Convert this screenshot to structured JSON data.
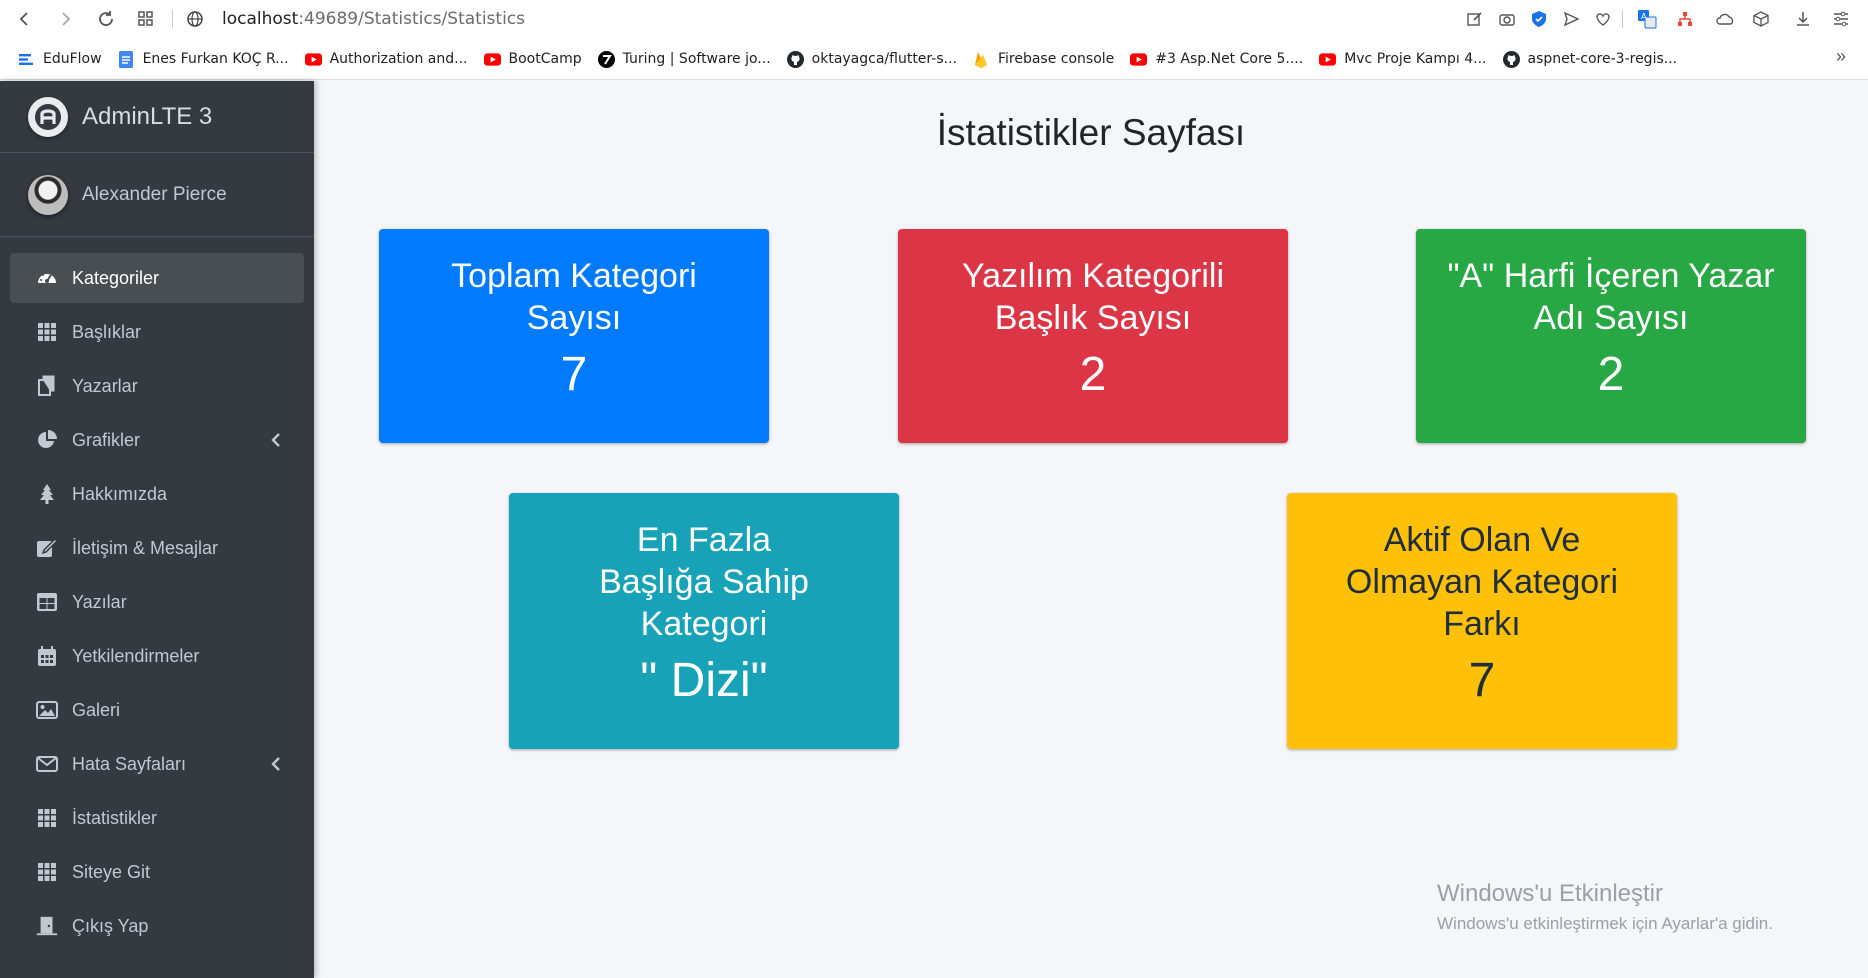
{
  "browser": {
    "url_host": "localhost",
    "url_path": ":49689/Statistics/Statistics",
    "bookmarks": [
      {
        "label": "EduFlow",
        "icon": "eduflow-icon",
        "color": "#1a73e8"
      },
      {
        "label": "Enes Furkan KOÇ R...",
        "icon": "docs-icon",
        "color": "#4285f4"
      },
      {
        "label": "Authorization and...",
        "icon": "youtube-icon",
        "color": "#ff0000"
      },
      {
        "label": "BootCamp",
        "icon": "youtube-icon",
        "color": "#ff0000"
      },
      {
        "label": "Turing | Software jo...",
        "icon": "turing-icon",
        "color": "#000000"
      },
      {
        "label": "oktayagca/flutter-s...",
        "icon": "github-icon",
        "color": "#24292e"
      },
      {
        "label": "Firebase console",
        "icon": "firebase-icon",
        "color": "#ffa000"
      },
      {
        "label": "#3 Asp.Net Core 5....",
        "icon": "youtube-icon",
        "color": "#ff0000"
      },
      {
        "label": "Mvc Proje Kampı 4...",
        "icon": "youtube-icon",
        "color": "#ff0000"
      },
      {
        "label": "aspnet-core-3-regis...",
        "icon": "github-icon",
        "color": "#24292e"
      }
    ]
  },
  "sidebar": {
    "brand": "AdminLTE 3",
    "user": "Alexander Pierce",
    "items": [
      {
        "label": "Kategoriler",
        "icon": "dashboard-icon",
        "active": true
      },
      {
        "label": "Başlıklar",
        "icon": "grid-icon"
      },
      {
        "label": "Yazarlar",
        "icon": "copy-icon"
      },
      {
        "label": "Grafikler",
        "icon": "pie-chart-icon",
        "chevron": true
      },
      {
        "label": "Hakkımızda",
        "icon": "tree-icon"
      },
      {
        "label": "İletişim & Mesajlar",
        "icon": "edit-icon"
      },
      {
        "label": "Yazılar",
        "icon": "table-icon"
      },
      {
        "label": "Yetkilendirmeler",
        "icon": "calendar-icon"
      },
      {
        "label": "Galeri",
        "icon": "image-icon"
      },
      {
        "label": "Hata Sayfaları",
        "icon": "envelope-icon",
        "chevron": true
      },
      {
        "label": "İstatistikler",
        "icon": "grid-icon"
      },
      {
        "label": "Siteye Git",
        "icon": "grid-icon"
      },
      {
        "label": "Çıkış Yap",
        "icon": "door-icon"
      }
    ]
  },
  "main": {
    "title": "İstatistikler Sayfası",
    "cards": [
      {
        "label": "Toplam Kategori Sayısı",
        "value": "7",
        "color": "#007bff"
      },
      {
        "label": "Yazılım Kategorili Başlık Sayısı",
        "value": "2",
        "color": "#dc3545"
      },
      {
        "label": "\"A\" Harfi İçeren Yazar Adı Sayısı",
        "value": "2",
        "color": "#28a745"
      },
      {
        "label": "En Fazla Başlığa Sahip Kategori",
        "value": "\" Dizi\"",
        "color": "#17a2b8"
      },
      {
        "label": "Aktif Olan Ve Olmayan Kategori Farkı",
        "value": "7",
        "color": "#ffc107"
      }
    ]
  },
  "watermark": {
    "title": "Windows'u Etkinleştir",
    "subtitle": "Windows'u etkinleştirmek için Ayarlar'a gidin."
  }
}
